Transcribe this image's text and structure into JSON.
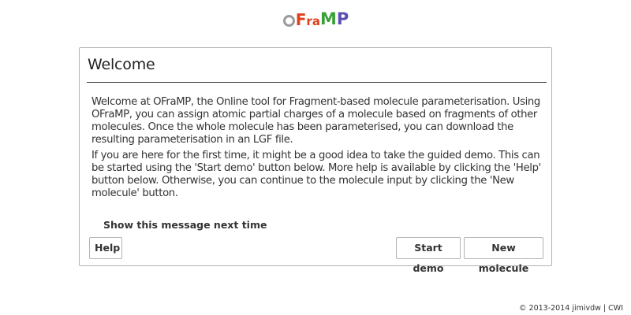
{
  "logo": {
    "letters": [
      "O",
      "F",
      "r",
      "a",
      "M",
      "P"
    ],
    "colors": {
      "O": "#9a9a9a",
      "F": "#e0401c",
      "r": "#e0401c",
      "a": "#e0401c",
      "M": "#3aa13a",
      "P": "#5a4fb0"
    }
  },
  "dialog": {
    "title": "Welcome",
    "paragraphs": [
      "Welcome at OFraMP, the Online tool for Fragment-based molecule parameterisation. Using OFraMP, you can assign atomic partial charges of a molecule based on fragments of other molecules. Once the whole molecule has been parameterised, you can download the resulting parameterisation in an LGF file.",
      "If you are here for the first time, it might be a good idea to take the guided demo. This can be started using the 'Start demo' button below. More help is available by clicking the 'Help' button below. Otherwise, you can continue to the molecule input by clicking the 'New molecule' button."
    ],
    "show_message_label": "Show this message next time",
    "buttons": {
      "help": "Help",
      "start_demo": "Start demo",
      "new_molecule": "New molecule"
    }
  },
  "footer": {
    "copyright": "© 2013-2014 jimivdw | CWI"
  },
  "colors": {
    "border": "#b3b3b3",
    "text": "#333333"
  }
}
